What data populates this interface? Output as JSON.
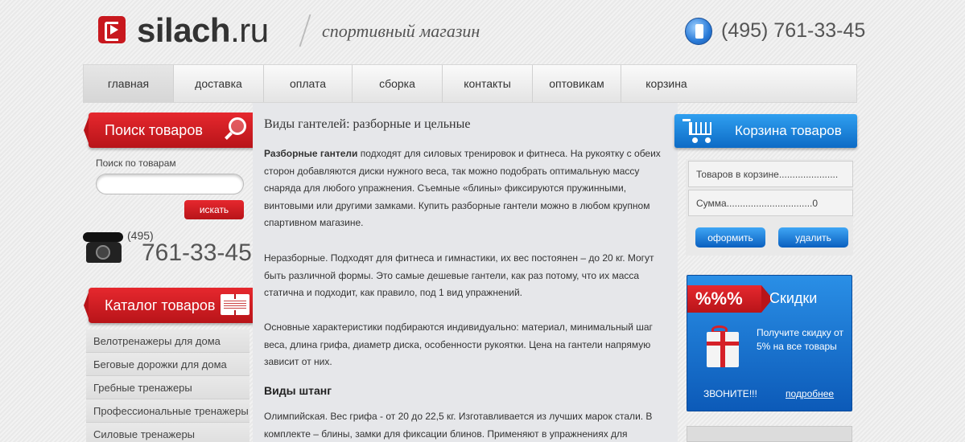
{
  "header": {
    "logo_text_bold": "silach",
    "logo_text_tld": ".ru",
    "tagline": "спортивный магазин",
    "phone": "(495) 761-33-45"
  },
  "nav": {
    "items": [
      {
        "label": "главная",
        "active": true
      },
      {
        "label": "доставка",
        "active": false
      },
      {
        "label": "оплата",
        "active": false
      },
      {
        "label": "сборка",
        "active": false
      },
      {
        "label": "контакты",
        "active": false
      },
      {
        "label": "оптовикам",
        "active": false
      },
      {
        "label": "корзина",
        "active": false
      }
    ]
  },
  "search": {
    "title": "Поиск товаров",
    "label": "Поиск по товарам",
    "input_value": "",
    "button_label": "искать"
  },
  "contact": {
    "code": "(495)",
    "number": "761-33-45"
  },
  "catalog": {
    "title": "Каталог товаров",
    "items": [
      "Велотренажеры для дома",
      "Беговые дорожки для дома",
      "Гребные тренажеры",
      "Профессиональные тренажеры",
      "Силовые тренажеры"
    ]
  },
  "article": {
    "title": "Виды гантелей: разборные и цельные",
    "p1_bold": "Разборные гантели",
    "p1_rest": " подходят для силовых тренировок и фитнеса. На рукоятку с обеих сторон добавляются диски нужного веса, так можно подобрать оптимальную массу снаряда для любого упражнения. Съемные «блины» фиксируются пружинными, винтовыми или другими замками. Купить разборные гантели можно в любом крупном спартивном магазине.",
    "p2": "Неразборные. Подходят для фитнеса и гимнастики, их вес постоянен – до 20 кг. Могут быть различной формы. Это самые дешевые гантели, как раз потому, что их масса статична и подходит, как правило, под 1 вид упражнений.",
    "p3": "Основные характеристики подбираются индивидуально: материал, минимальный шаг веса, длина грифа, диаметр диска, особенности рукоятки. Цена на гантели напрямую зависит от них.",
    "subhead": "Виды штанг",
    "p4": "Олимпийская. Вес грифа - от 20 до 22,5 кг. Изготавливается из лучших марок стали. В комплекте – блины, замки для фиксации блинов. Применяют в упражнениях для"
  },
  "cart": {
    "title": "Корзина товаров",
    "items_row": "Товаров в корзине......................",
    "sum_row": "Сумма................................0",
    "checkout_label": "оформить",
    "delete_label": "удалить"
  },
  "discount": {
    "badge": "%%%",
    "title": "Скидки",
    "text": "Получите скидку от 5% на все товары",
    "call": "ЗВОНИТЕ!!!",
    "more": "подробнее"
  }
}
